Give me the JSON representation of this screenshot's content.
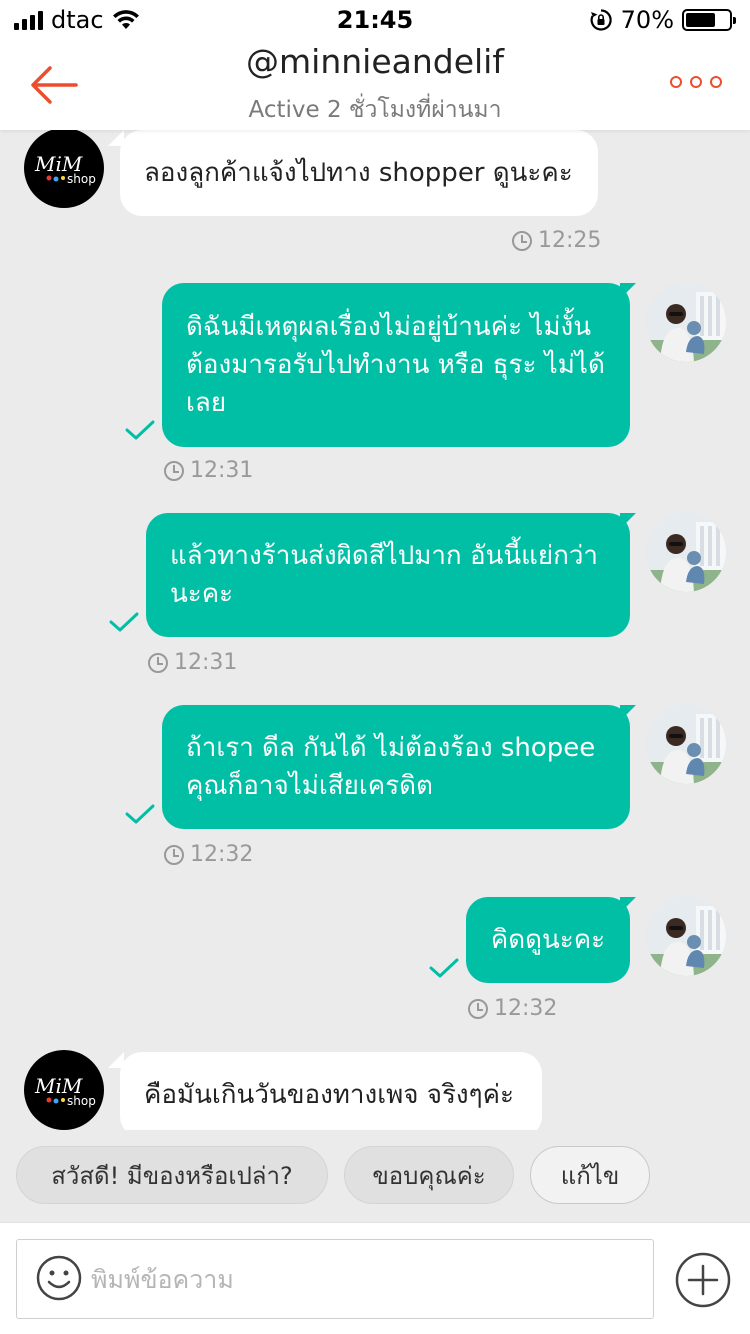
{
  "status_bar": {
    "carrier": "dtac",
    "time": "21:45",
    "battery": "70%",
    "battery_level": 0.7
  },
  "header": {
    "title": "@minnieandelif",
    "subtitle": "Active 2 ชั่วโมงที่ผ่านมา"
  },
  "shop_avatar_text": {
    "line1": "MiM",
    "line2": "shop"
  },
  "messages": [
    {
      "text": "ลองลูกค้าแจ้งไปทาง shopper ดูนะคะ",
      "time": "12:25",
      "direction": "in"
    },
    {
      "lines": [
        "ดิฉันมีเหตุผลเรื่องไม่อยู่บ้านค่ะ ไม่งั้น",
        "ต้องมารอรับไปทำงาน หรือ ธุระ ไม่ได้",
        "เลย"
      ],
      "time": "12:31",
      "direction": "out"
    },
    {
      "lines": [
        "แล้วทางร้านส่งผิดสีไปมาก อันนี้แย่กว่า",
        "นะคะ"
      ],
      "time": "12:31",
      "direction": "out"
    },
    {
      "lines": [
        "ถ้าเรา ดีล กันได้ ไม่ต้องร้อง shopee",
        "คุณก็อาจไม่เสียเครดิต"
      ],
      "time": "12:32",
      "direction": "out"
    },
    {
      "text": "คิดดูนะคะ",
      "time": "12:32",
      "direction": "out"
    },
    {
      "text": "คือมันเกินวันของทางเพจ จริงๆค่ะ",
      "direction": "in"
    }
  ],
  "quick_replies": [
    "สวัสดี! มีของหรือเปล่า?",
    "ขอบคุณค่ะ",
    "แก้ไข"
  ],
  "input": {
    "placeholder": "พิมพ์ข้อความ"
  },
  "colors": {
    "accent": "#ee4d2d",
    "bubble_out": "#00bfa5",
    "background": "#ebebeb"
  }
}
